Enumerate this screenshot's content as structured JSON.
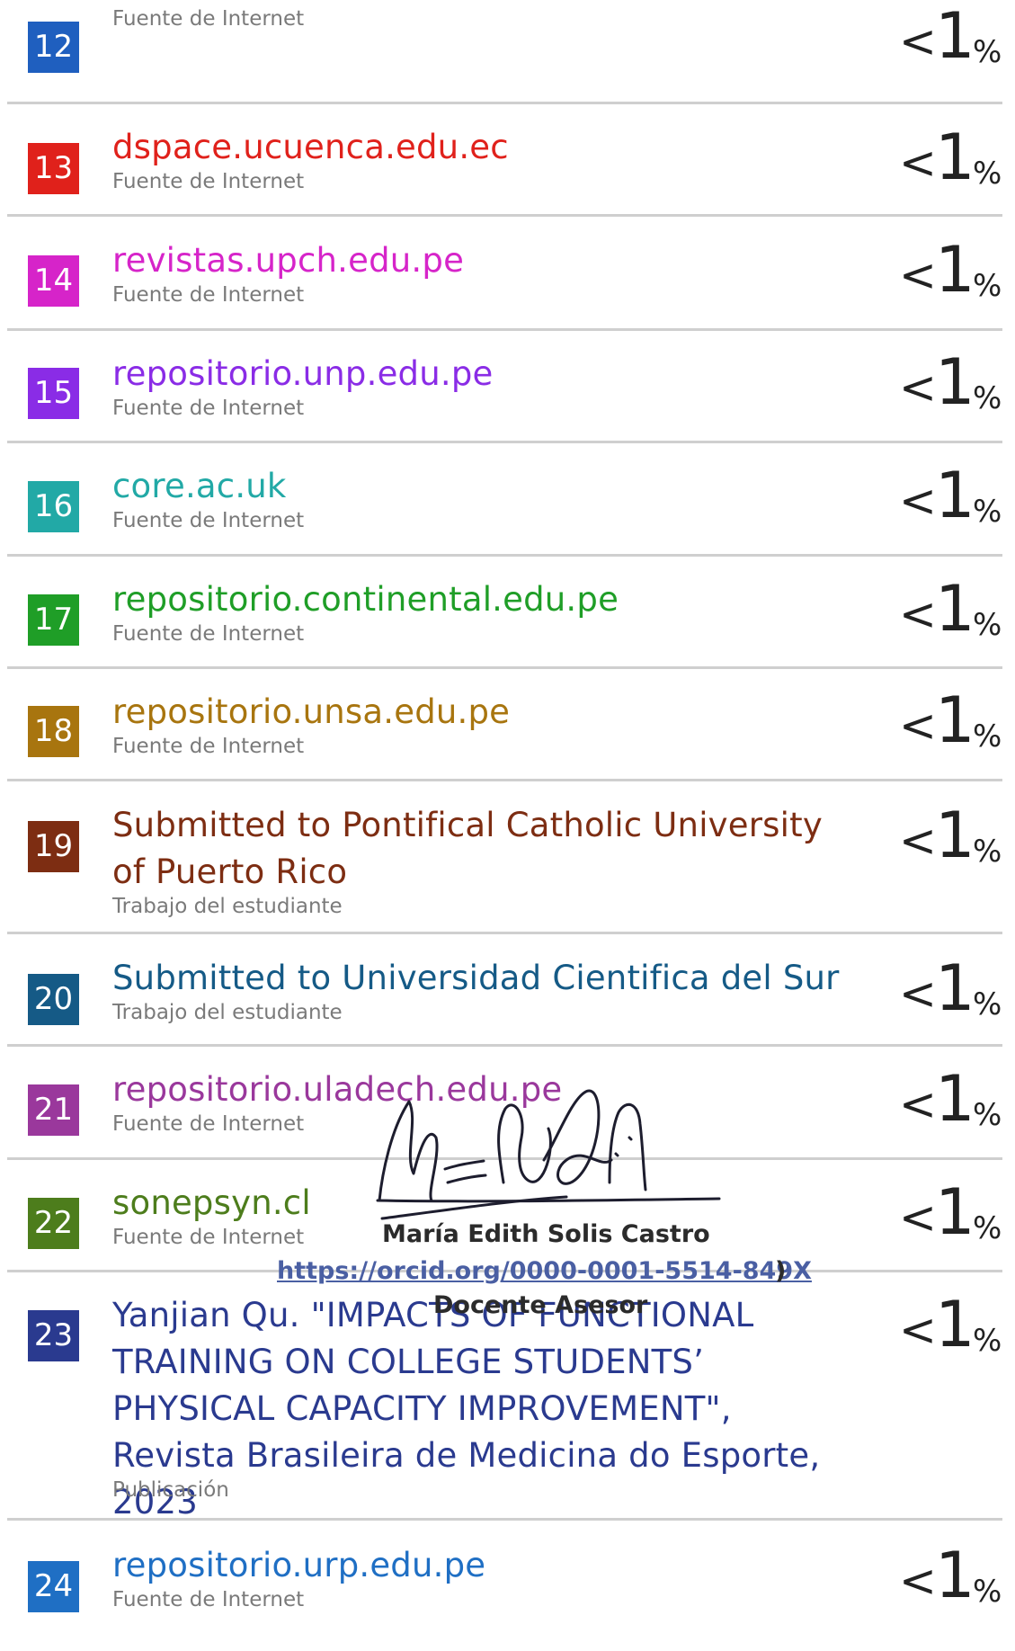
{
  "items": [
    {
      "number": "12",
      "title": "",
      "source_type": "Fuente de Internet",
      "less_than": "<",
      "percent_value": "1",
      "percent_sign": "%",
      "color": "#1f5fbf"
    },
    {
      "number": "13",
      "title": "dspace.ucuenca.edu.ec",
      "source_type": "Fuente de Internet",
      "less_than": "<",
      "percent_value": "1",
      "percent_sign": "%",
      "color": "#e0211b"
    },
    {
      "number": "14",
      "title": "revistas.upch.edu.pe",
      "source_type": "Fuente de Internet",
      "less_than": "<",
      "percent_value": "1",
      "percent_sign": "%",
      "color": "#d624c9"
    },
    {
      "number": "15",
      "title": "repositorio.unp.edu.pe",
      "source_type": "Fuente de Internet",
      "less_than": "<",
      "percent_value": "1",
      "percent_sign": "%",
      "color": "#8a2ce6"
    },
    {
      "number": "16",
      "title": "core.ac.uk",
      "source_type": "Fuente de Internet",
      "less_than": "<",
      "percent_value": "1",
      "percent_sign": "%",
      "color": "#22a9a6"
    },
    {
      "number": "17",
      "title": "repositorio.continental.edu.pe",
      "source_type": "Fuente de Internet",
      "less_than": "<",
      "percent_value": "1",
      "percent_sign": "%",
      "color": "#1f9e27"
    },
    {
      "number": "18",
      "title": "repositorio.unsa.edu.pe",
      "source_type": "Fuente de Internet",
      "less_than": "<",
      "percent_value": "1",
      "percent_sign": "%",
      "color": "#a8750f"
    },
    {
      "number": "19",
      "title": "Submitted to Pontifical Catholic University of Puerto Rico",
      "source_type": "Trabajo del estudiante",
      "less_than": "<",
      "percent_value": "1",
      "percent_sign": "%",
      "color": "#7d2d12"
    },
    {
      "number": "20",
      "title": "Submitted to Universidad Cientifica del Sur",
      "source_type": "Trabajo del estudiante",
      "less_than": "<",
      "percent_value": "1",
      "percent_sign": "%",
      "color": "#155a86"
    },
    {
      "number": "21",
      "title": "repositorio.uladech.edu.pe",
      "source_type": "Fuente de Internet",
      "less_than": "<",
      "percent_value": "1",
      "percent_sign": "%",
      "color": "#9a389c"
    },
    {
      "number": "22",
      "title": "sonepsyn.cl",
      "source_type": "Fuente de Internet",
      "less_than": "<",
      "percent_value": "1",
      "percent_sign": "%",
      "color": "#4d7d1c"
    },
    {
      "number": "23",
      "title": "Yanjian Qu. \"IMPACTS OF FUNCTIONAL TRAINING ON COLLEGE STUDENTS’ PHYSICAL CAPACITY IMPROVEMENT\", Revista Brasileira de Medicina do Esporte, 2023",
      "source_type": "Publicación",
      "less_than": "<",
      "percent_value": "1",
      "percent_sign": "%",
      "color": "#2a3a8f"
    },
    {
      "number": "24",
      "title": "repositorio.urp.edu.pe",
      "source_type": "Fuente de Internet",
      "less_than": "<",
      "percent_value": "1",
      "percent_sign": "%",
      "color": "#1f6fc4"
    }
  ],
  "signature": {
    "name": "María Edith Solis Castro",
    "orcid": "https://orcid.org/0000-0001-5514-849X",
    "closing": ")",
    "role": "Docente Asesor"
  }
}
